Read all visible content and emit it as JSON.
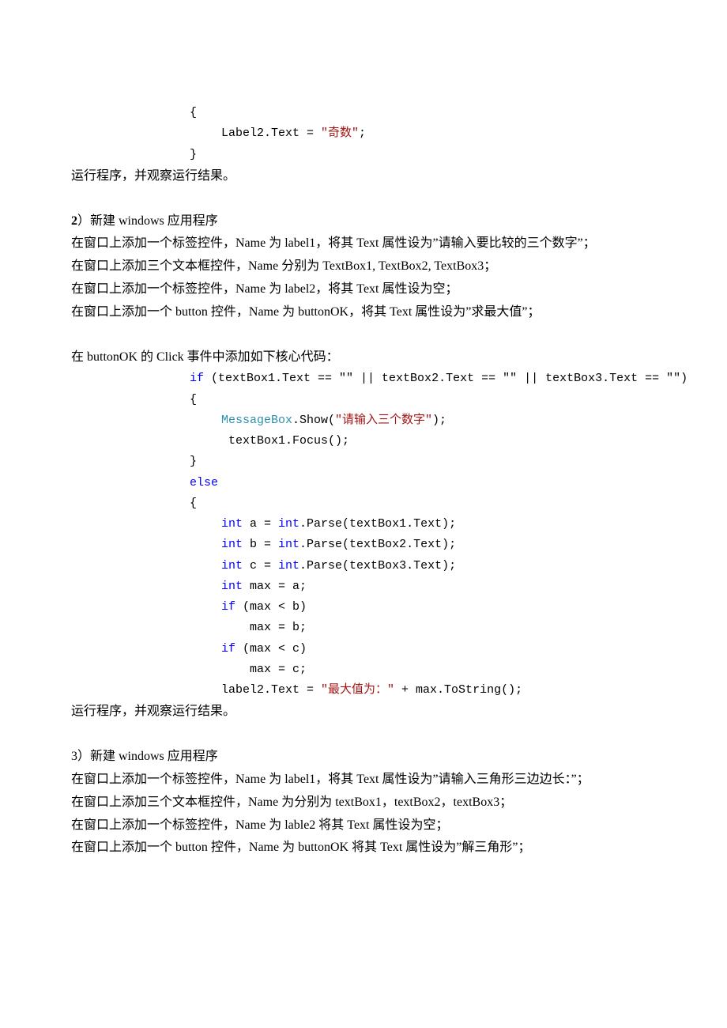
{
  "code1": {
    "brace_open": "{",
    "stmt_prefix": "Label2.Text = ",
    "str": "\"奇数\"",
    "semicolon": ";",
    "brace_close": "}"
  },
  "afterCode1": "运行程序，并观察运行结果。",
  "section2": {
    "title_prefix": "2",
    "title_rest": "）新建 windows 应用程序",
    "line1": "在窗口上添加一个标签控件，Name 为 label1，将其 Text 属性设为”请输入要比较的三个数字”；",
    "line2": "在窗口上添加三个文本框控件，Name 分别为 TextBox1, TextBox2, TextBox3；",
    "line3": "在窗口上添加一个标签控件，Name 为 label2，将其 Text 属性设为空；",
    "line4": "在窗口上添加一个 button 控件，Name 为 buttonOK，将其 Text 属性设为”求最大值”；",
    "line5": "在 buttonOK 的 Click 事件中添加如下核心代码："
  },
  "code2": {
    "if_kw": "if",
    "if_cond": " (textBox1.Text == \"\" || textBox2.Text == \"\" || textBox3.Text == \"\")",
    "brace_open": "{",
    "mb_cls": "MessageBox",
    "mb_call_prefix": ".Show(",
    "mb_str": "\"请输入三个数字\"",
    "mb_call_suffix": ");",
    "focus": " textBox1.Focus();",
    "brace_close1": "}",
    "else_kw": "else",
    "brace_open2": "{",
    "int_kw": "int",
    "a_decl_mid": " a = ",
    "a_decl_end": ".Parse(textBox1.Text);",
    "b_decl_mid": " b = ",
    "b_decl_end": ".Parse(textBox2.Text);",
    "c_decl_mid": " c = ",
    "c_decl_end": ".Parse(textBox3.Text);",
    "max_decl": " max = a;",
    "if2_cond": " (max < b)",
    "max_b": "    max = b;",
    "if3_cond": " (max < c)",
    "max_c": "    max = c;",
    "lbl_assign_prefix": "label2.Text = ",
    "lbl_str": "\"最大值为：\"",
    "lbl_assign_suffix": " + max.ToString();"
  },
  "afterCode2": "运行程序，并观察运行结果。",
  "section3": {
    "title": "3）新建 windows 应用程序",
    "line1": "在窗口上添加一个标签控件，Name 为 label1，将其 Text 属性设为”请输入三角形三边边长：”；",
    "line2": "在窗口上添加三个文本框控件，Name 为分别为 textBox1，textBox2，textBox3；",
    "line3": "在窗口上添加一个标签控件，Name 为 lable2 将其 Text 属性设为空；",
    "line4": "在窗口上添加一个 button 控件，Name 为 buttonOK 将其 Text 属性设为”解三角形”；"
  }
}
